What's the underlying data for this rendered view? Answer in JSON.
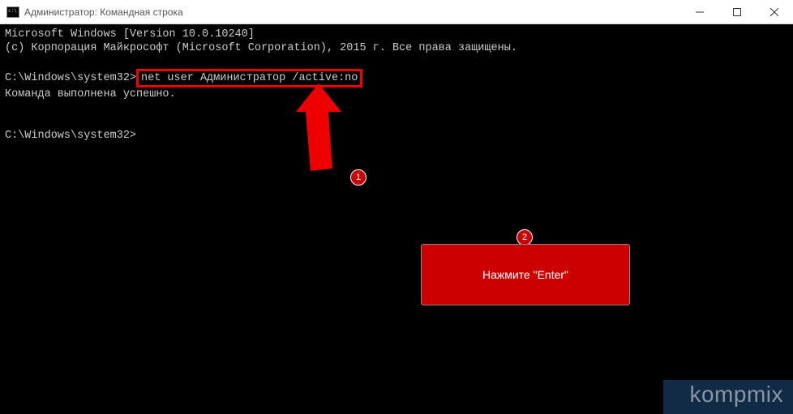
{
  "window": {
    "title": "Администратор: Командная строка"
  },
  "terminal": {
    "line1": "Microsoft Windows [Version 10.0.10240]",
    "line2": "(c) Корпорация Майкрософт (Microsoft Corporation), 2015 г. Все права защищены.",
    "prompt1": "C:\\Windows\\system32>",
    "command": "net user Администратор /active:no",
    "result": "Команда выполнена успешно.",
    "prompt2": "C:\\Windows\\system32>"
  },
  "annotations": {
    "badge1": "1",
    "badge2": "2",
    "callout": "Нажмите \"Enter\""
  },
  "watermark": "kompmix"
}
